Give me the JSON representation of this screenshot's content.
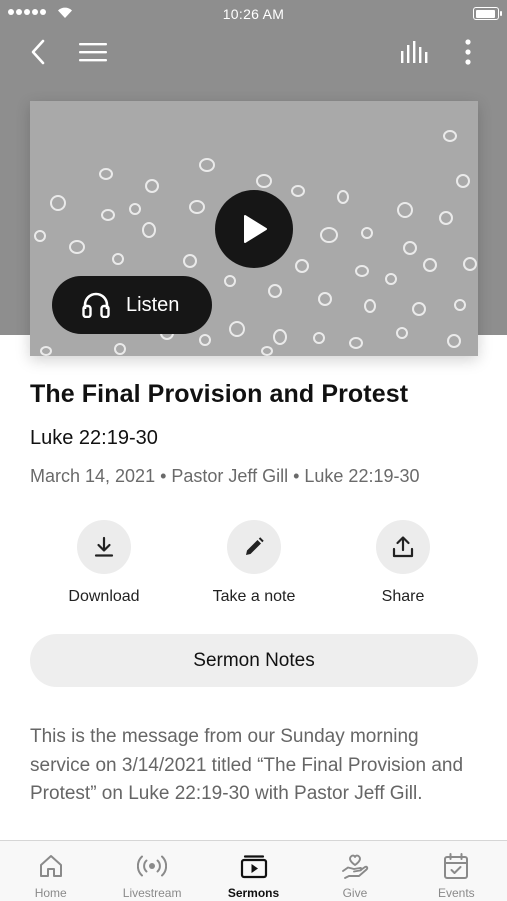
{
  "status_bar": {
    "time": "10:26 AM"
  },
  "media": {
    "listen_label": "Listen"
  },
  "sermon": {
    "title": "The Final Provision and Protest",
    "scripture": "Luke 22:19-30",
    "meta": "March 14, 2021 • Pastor Jeff Gill • Luke 22:19-30",
    "description": "This is the message from our Sunday morning service on 3/14/2021 titled “The Final Provision and Protest” on Luke 22:19-30 with Pastor Jeff Gill."
  },
  "actions": {
    "download": "Download",
    "note": "Take a note",
    "share": "Share"
  },
  "notes_button": "Sermon Notes",
  "tabs": [
    {
      "label": "Home",
      "icon": "home-icon"
    },
    {
      "label": "Livestream",
      "icon": "broadcast-icon"
    },
    {
      "label": "Sermons",
      "icon": "video-library-icon",
      "active": true
    },
    {
      "label": "Give",
      "icon": "give-hand-heart-icon"
    },
    {
      "label": "Events",
      "icon": "calendar-check-icon"
    }
  ],
  "colors": {
    "hero_background": "#8e8e8e",
    "media_background": "#a9a9a9",
    "button_dark": "#161616",
    "pill_background": "#eeeeee"
  }
}
